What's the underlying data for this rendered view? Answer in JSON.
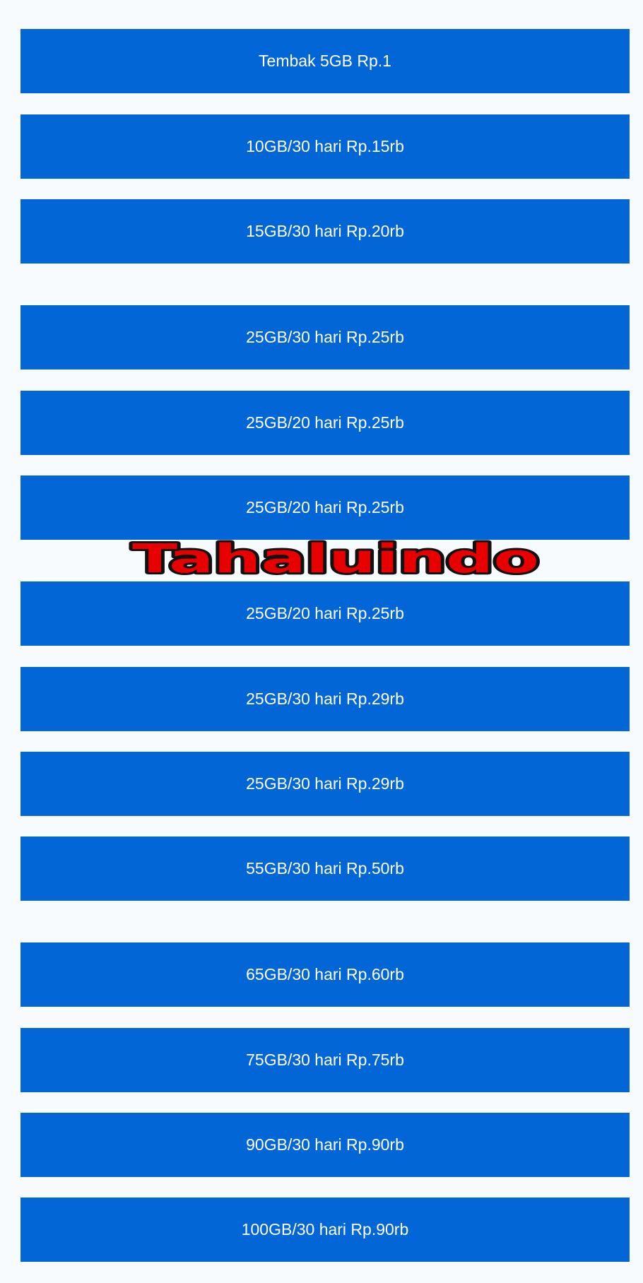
{
  "packages": [
    {
      "label": "Tembak 5GB Rp.1"
    },
    {
      "label": "10GB/30 hari Rp.15rb"
    },
    {
      "label": "15GB/30 hari Rp.20rb"
    },
    {
      "label": "25GB/30 hari Rp.25rb"
    },
    {
      "label": "25GB/20 hari Rp.25rb"
    },
    {
      "label": "25GB/20 hari Rp.25rb"
    },
    {
      "label": "25GB/20 hari Rp.25rb"
    },
    {
      "label": "25GB/30 hari Rp.29rb"
    },
    {
      "label": "25GB/30 hari Rp.29rb"
    },
    {
      "label": "55GB/30 hari Rp.50rb"
    },
    {
      "label": "65GB/30 hari Rp.60rb"
    },
    {
      "label": "75GB/30 hari Rp.75rb"
    },
    {
      "label": "90GB/30 hari Rp.90rb"
    },
    {
      "label": "100GB/30 hari Rp.90rb"
    }
  ],
  "watermark": {
    "text": "Tahaluindo",
    "fill_color": "#e80000",
    "outline_color": "#111111"
  },
  "colors": {
    "button_bg": "#0366d6",
    "button_text": "#ffffff",
    "page_bg": "#f7fbfe"
  }
}
